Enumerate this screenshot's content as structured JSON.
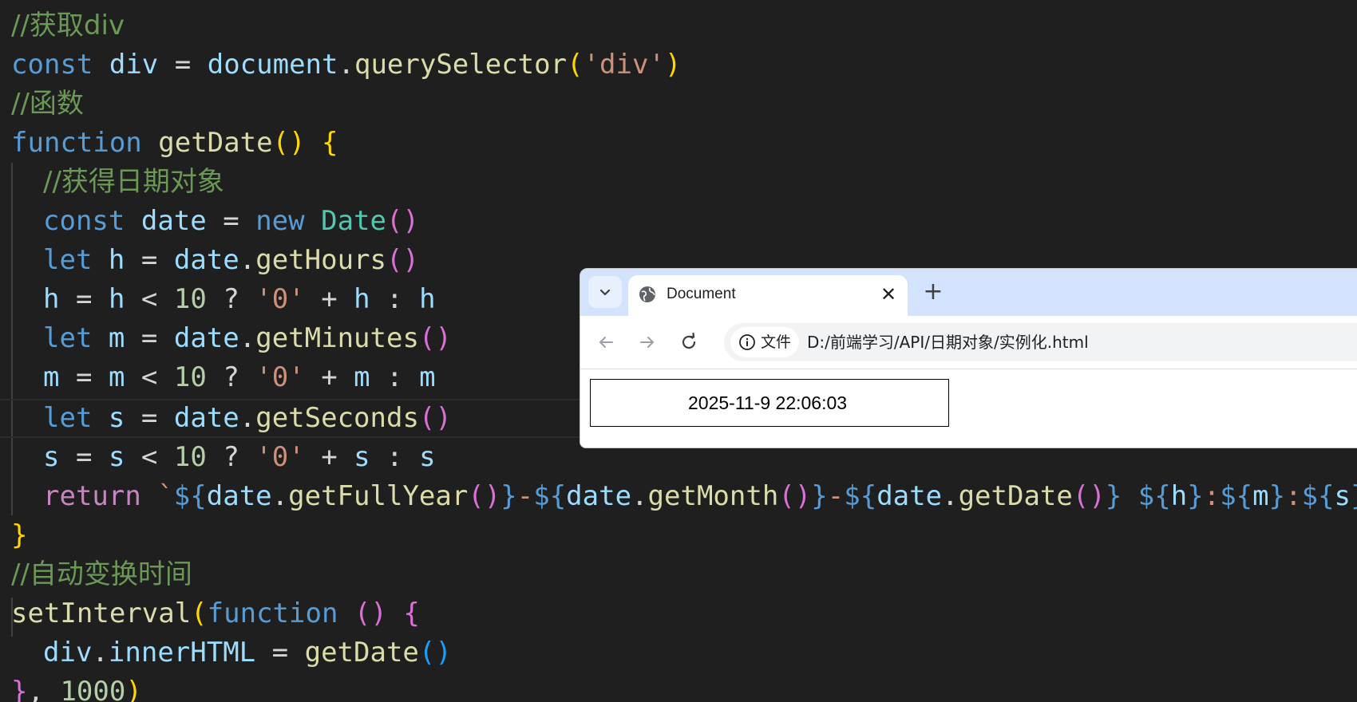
{
  "editor": {
    "lines": {
      "l1_comment": "//获取div",
      "l2": {
        "kw": "const",
        "var": "div",
        "eq": "=",
        "obj": "document",
        "dot": ".",
        "fn": "querySelector",
        "open": "(",
        "str": "'div'",
        "close": ")"
      },
      "l3_comment": "//函数",
      "l4": {
        "kw": "function",
        "fn": "getDate",
        "parens": "()",
        "brace": "{"
      },
      "l5_comment": "//获得日期对象",
      "l6": {
        "kw": "const",
        "var": "date",
        "eq": "=",
        "new": "new",
        "cls": "Date",
        "parens": "()"
      },
      "l7": {
        "kw": "let",
        "var": "h",
        "eq": "=",
        "obj": "date",
        "dot": ".",
        "fn": "getHours",
        "parens": "()"
      },
      "l8": {
        "a": "h",
        "eq": "=",
        "b": "h",
        "lt": "<",
        "num": "10",
        "q": "?",
        "str": "'0'",
        "plus": "+",
        "c": "h",
        "colon": ":",
        "d": "h"
      },
      "l9": {
        "kw": "let",
        "var": "m",
        "eq": "=",
        "obj": "date",
        "dot": ".",
        "fn": "getMinutes",
        "parens": "()"
      },
      "l10": {
        "a": "m",
        "eq": "=",
        "b": "m",
        "lt": "<",
        "num": "10",
        "q": "?",
        "str": "'0'",
        "plus": "+",
        "c": "m",
        "colon": ":",
        "d": "m"
      },
      "l11": {
        "kw": "let",
        "var": "s",
        "eq": "=",
        "obj": "date",
        "dot": ".",
        "fn": "getSeconds",
        "parens": "()"
      },
      "l12": {
        "a": "s",
        "eq": "=",
        "b": "s",
        "lt": "<",
        "num": "10",
        "q": "?",
        "str": "'0'",
        "plus": "+",
        "c": "s",
        "colon": ":",
        "d": "s"
      },
      "l13": {
        "kw": "return",
        "tick": "`",
        "t1o": "${",
        "o1": "date",
        "dot": ".",
        "f1": "getFullYear",
        "p": "()",
        "t1c": "}",
        "dash": "-",
        "t2o": "${",
        "o2": "date",
        "f2": "getMonth",
        "t2c": "}",
        "t3o": "${",
        "o3": "date",
        "f3": "getDate",
        "t3c": "}",
        "t4o": "${",
        "v4": "h",
        "t4c": "}",
        "col": ":",
        "t5o": "${",
        "v5": "m",
        "t5c": "}",
        "t6o": "${",
        "v6": "s",
        "t6c": "}",
        "tick_end": "`"
      },
      "l14_brace": "}",
      "l15_comment": "//自动变换时间",
      "l16": {
        "fn": "setInterval",
        "open": "(",
        "kw": "function",
        "parens": "()",
        "brace": "{"
      },
      "l17": {
        "obj": "div",
        "dot": ".",
        "prop": "innerHTML",
        "eq": "=",
        "fn": "getDate",
        "parens": "()"
      },
      "l18": {
        "brace": "}",
        "comma": ",",
        "num": "1000",
        "close": ")"
      }
    }
  },
  "browser": {
    "tab_title": "Document",
    "tab_close": "✕",
    "new_tab": "+",
    "chip_label": "文件",
    "url": "D:/前端学习/API/日期对象/实例化.html",
    "page_div_text": "2025-11-9 22:06:03"
  },
  "colors": {
    "editor_bg": "#1f1f1f",
    "tabstrip_bg": "#d3e3fd",
    "comment": "#6a9955",
    "keyword": "#569cd6",
    "function": "#dcdcaa",
    "string": "#ce9178"
  }
}
